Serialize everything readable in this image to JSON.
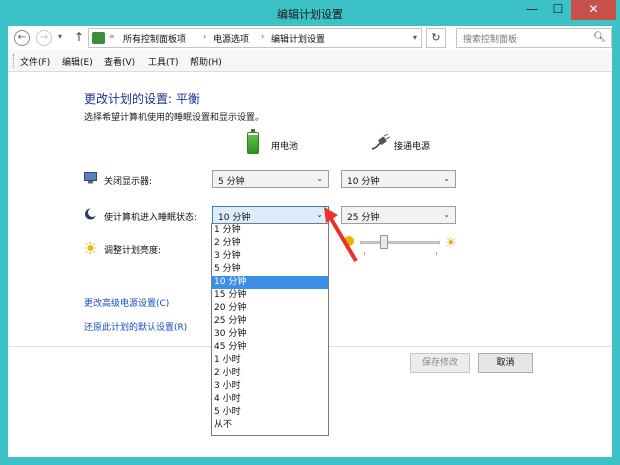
{
  "window": {
    "title": "编辑计划设置",
    "min": "—",
    "max": "☐",
    "close": "✕"
  },
  "nav": {
    "back": "←",
    "forward": "→",
    "dropdown": "▾",
    "up": "↑",
    "breadcrumb_prefix": "«",
    "breadcrumbs": [
      "所有控制面板项",
      "电源选项",
      "编辑计划设置"
    ],
    "crumb_arrow": "›",
    "refresh": "↻",
    "search_placeholder": "搜索控制面板",
    "search_icon": "search-icon"
  },
  "menu": [
    "文件(F)",
    "编辑(E)",
    "查看(V)",
    "工具(T)",
    "帮助(H)"
  ],
  "main": {
    "heading": "更改计划的设置: 平衡",
    "subheading": "选择希望计算机使用的睡眠设置和显示设置。",
    "on_battery": "用电池",
    "plugged_in": "接通电源",
    "rows": [
      {
        "label": "关闭显示器:",
        "battery": "5 分钟",
        "plugged": "10 分钟"
      },
      {
        "label": "使计算机进入睡眠状态:",
        "battery": "10 分钟",
        "plugged": "25 分钟"
      },
      {
        "label": "调整计划亮度:"
      }
    ],
    "link_advanced": "更改高级电源设置(C)",
    "link_restore": "还原此计划的默认设置(R)",
    "save_button": "保存修改",
    "cancel_button": "取消"
  },
  "sleep_dropdown": {
    "selected": "10 分钟",
    "options": [
      "1 分钟",
      "2 分钟",
      "3 分钟",
      "5 分钟",
      "10 分钟",
      "15 分钟",
      "20 分钟",
      "25 分钟",
      "30 分钟",
      "45 分钟",
      "1 小时",
      "2 小时",
      "3 小时",
      "4 小时",
      "5 小时",
      "从不"
    ]
  },
  "colors": {
    "window_frame": "#3cc1c6",
    "close_button": "#c7504b",
    "heading": "#1e3287",
    "link": "#1a4ec4",
    "selection": "#3d8ee6",
    "annotation_arrow": "#e8322a"
  }
}
